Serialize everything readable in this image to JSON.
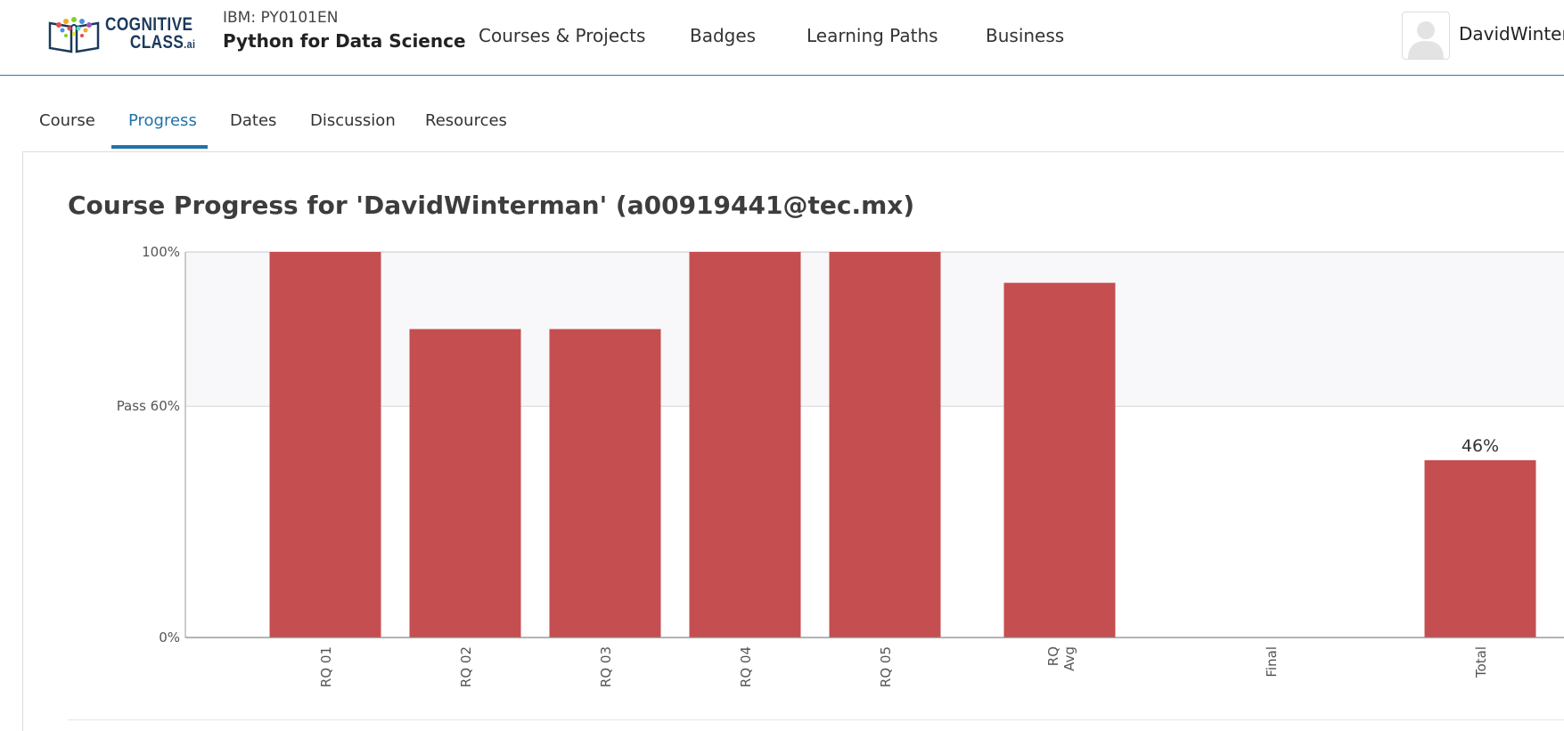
{
  "header": {
    "logo": {
      "line1": "COGNITIVE",
      "line2": "CLASS",
      "suffix": ".ai"
    },
    "course_code": "IBM: PY0101EN",
    "course_name": "Python for Data Science",
    "nav": [
      {
        "label": "Courses & Projects"
      },
      {
        "label": "Badges"
      },
      {
        "label": "Learning Paths"
      },
      {
        "label": "Business"
      }
    ],
    "username": "DavidWinterman"
  },
  "tabs": [
    {
      "label": "Course",
      "active": false
    },
    {
      "label": "Progress",
      "active": true
    },
    {
      "label": "Dates",
      "active": false
    },
    {
      "label": "Discussion",
      "active": false
    },
    {
      "label": "Resources",
      "active": false
    }
  ],
  "page_title": "Course Progress for 'DavidWinterman' (a00919441@tec.mx)",
  "colors": {
    "accent": "#1f73a8",
    "bar": "#c44a4c",
    "plot_bg": "#f8f8fa"
  },
  "chart_data": {
    "type": "bar",
    "categories": [
      "RQ 01",
      "RQ 02",
      "RQ 03",
      "RQ 04",
      "RQ 05",
      "RQ Avg",
      "Final",
      "Total"
    ],
    "values": [
      100,
      80,
      80,
      100,
      100,
      92,
      0,
      46
    ],
    "value_labels": {
      "Total": "46%"
    },
    "y_ticks": [
      {
        "value": 100,
        "label": "100%"
      },
      {
        "value": 60,
        "label": "Pass 60%"
      },
      {
        "value": 0,
        "label": "0%"
      }
    ],
    "ylim": [
      0,
      100
    ],
    "pass_threshold": 60
  }
}
